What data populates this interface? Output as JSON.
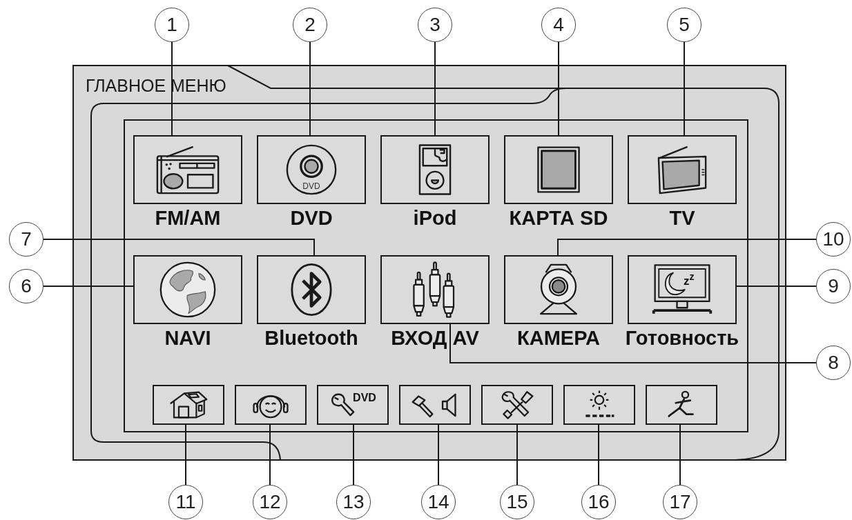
{
  "callouts": [
    "1",
    "2",
    "3",
    "4",
    "5",
    "7",
    "10",
    "6",
    "9",
    "8"
  ],
  "screen": {
    "title": "ГЛАВНОЕ МЕНЮ",
    "main_buttons": [
      {
        "label": "FM/AM"
      },
      {
        "label": "DVD",
        "icon_text": "DVD"
      },
      {
        "label": "iPod"
      },
      {
        "label": "КАРТА SD"
      },
      {
        "label": "TV"
      },
      {
        "label": "NAVI"
      },
      {
        "label": "Bluetooth"
      },
      {
        "label": "ВХОД AV"
      },
      {
        "label": "КАМЕРА"
      },
      {
        "label": "Готовность",
        "icon_text": "z$^{z}$"
      }
    ],
    "toolbar_buttons": [
      {
        "callout": "11"
      },
      {
        "callout": "12"
      },
      {
        "icon_text": "DVD",
        "callout": "13"
      },
      {
        "callout": "14"
      },
      {
        "callout": "15"
      },
      {
        "callout": "16"
      },
      {
        "callout": "17"
      }
    ]
  }
}
